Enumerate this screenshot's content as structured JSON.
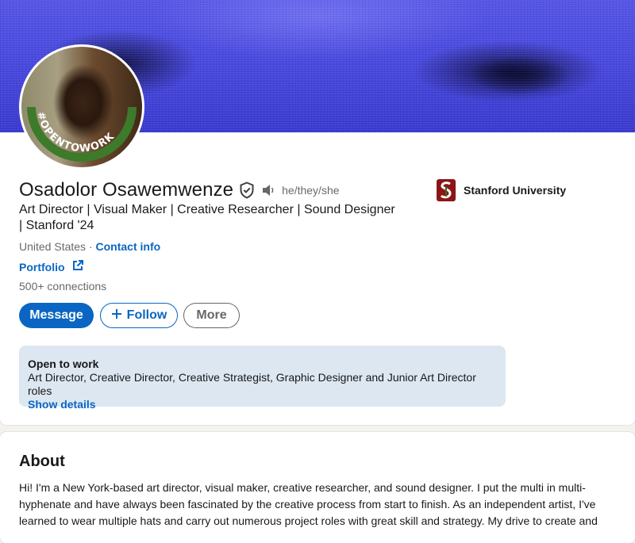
{
  "profile": {
    "name": "Osadolor Osawemwenze",
    "pronouns": "he/they/she",
    "headline": "Art Director | Visual Maker | Creative Researcher | Sound Designer | Stanford '24",
    "location": "United States",
    "separator": "·",
    "contact_info_label": "Contact info",
    "portfolio_label": "Portfolio",
    "connections": "500+ connections",
    "badge_text": "#OPENTOWORK"
  },
  "education": {
    "school": "Stanford University"
  },
  "actions": {
    "message_label": "Message",
    "follow_label": "Follow",
    "more_label": "More"
  },
  "open_to_work": {
    "title": "Open to work",
    "roles": "Art Director, Creative Director, Creative Strategist, Graphic Designer and Junior Art Director roles",
    "show_details_label": "Show details"
  },
  "about": {
    "title": "About",
    "text": "Hi! I'm a New York-based art director, visual maker, creative researcher, and sound designer. I put the multi in multi-hyphenate and have always been fascinated by the creative process from start to finish. As an independent artist, I've learned to wear multiple hats and carry out numerous project roles with great skill and strategy. My drive to create and"
  },
  "icons": {
    "verify": "shield-check-icon",
    "speaker": "speaker-icon",
    "external_link": "external-link-icon",
    "plus": "plus-icon",
    "school_logo": "stanford-logo"
  },
  "colors": {
    "brand_blue": "#0a66c2",
    "open_to_work_green": "#3d7a2a",
    "banner_blue": "#4a4ae0",
    "stanford_red": "#8c1515"
  }
}
